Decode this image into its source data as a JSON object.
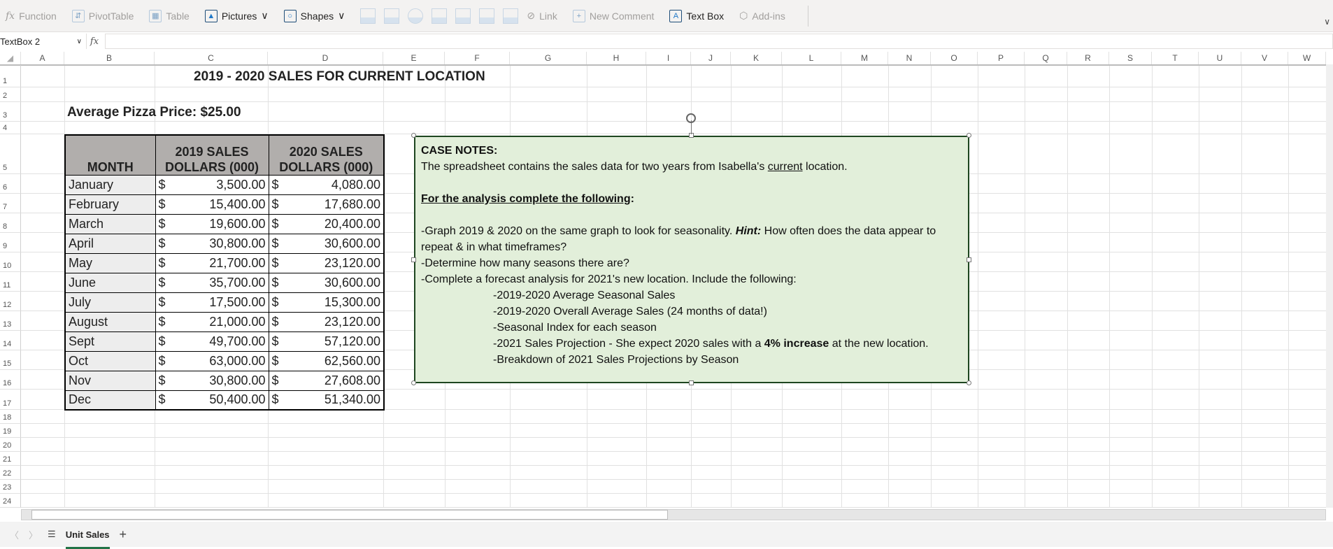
{
  "toolbar": {
    "items": [
      {
        "label": "Function",
        "icon": "fx-icon",
        "enabled": false
      },
      {
        "label": "PivotTable",
        "icon": "pivottable-icon",
        "enabled": false
      },
      {
        "label": "Table",
        "icon": "table-icon",
        "enabled": false
      },
      {
        "label": "Pictures",
        "icon": "pictures-icon",
        "enabled": true,
        "dropdown": "∨"
      },
      {
        "label": "Shapes",
        "icon": "shapes-icon",
        "enabled": true,
        "dropdown": "∨"
      }
    ],
    "link": "Link",
    "new_comment": "New Comment",
    "text_box": "Text Box",
    "addins": "Add-ins"
  },
  "formula_bar": {
    "name_box": "TextBox 2",
    "fx": "fx",
    "value": ""
  },
  "columns": [
    "A",
    "B",
    "C",
    "D",
    "E",
    "F",
    "G",
    "H",
    "I",
    "J",
    "K",
    "L",
    "M",
    "N",
    "O",
    "P",
    "Q",
    "R",
    "S",
    "T",
    "U",
    "V",
    "W"
  ],
  "rows": [
    "1",
    "2",
    "3",
    "4",
    "5",
    "6",
    "7",
    "8",
    "9",
    "10",
    "11",
    "12",
    "13",
    "14",
    "15",
    "16",
    "17",
    "18",
    "19",
    "20",
    "21",
    "22",
    "23",
    "24"
  ],
  "sheet": {
    "title": "2019 - 2020 SALES FOR CURRENT LOCATION",
    "avg_price": "Average Pizza Price: $25.00",
    "headers": {
      "month": "MONTH",
      "y2019_1": "2019 SALES",
      "y2019_2": "DOLLARS (000)",
      "y2020_1": "2020 SALES",
      "y2020_2": "DOLLARS (000)"
    },
    "currency": "$",
    "data": [
      {
        "month": "January",
        "s2019": "3,500.00",
        "s2020": "4,080.00"
      },
      {
        "month": "February",
        "s2019": "15,400.00",
        "s2020": "17,680.00"
      },
      {
        "month": "March",
        "s2019": "19,600.00",
        "s2020": "20,400.00"
      },
      {
        "month": "April",
        "s2019": "30,800.00",
        "s2020": "30,600.00"
      },
      {
        "month": "May",
        "s2019": "21,700.00",
        "s2020": "23,120.00"
      },
      {
        "month": "June",
        "s2019": "35,700.00",
        "s2020": "30,600.00"
      },
      {
        "month": "July",
        "s2019": "17,500.00",
        "s2020": "15,300.00"
      },
      {
        "month": "August",
        "s2019": "21,000.00",
        "s2020": "23,120.00"
      },
      {
        "month": "Sept",
        "s2019": "49,700.00",
        "s2020": "57,120.00"
      },
      {
        "month": "Oct",
        "s2019": "63,000.00",
        "s2020": "62,560.00"
      },
      {
        "month": "Nov",
        "s2019": "30,800.00",
        "s2020": "27,608.00"
      },
      {
        "month": "Dec",
        "s2019": "50,400.00",
        "s2020": "51,340.00"
      }
    ]
  },
  "textbox": {
    "heading": "CASE NOTES:",
    "intro_a": "The spreadsheet contains the sales data for two years from Isabella's ",
    "intro_u": "current",
    "intro_b": " location.",
    "subheading": "For the analysis complete the following",
    "colon": ":",
    "l1a": "-Graph 2019 & 2020 on the same graph to look for seasonality. ",
    "l1hint": "Hint:",
    "l1b": " How often does the data appear to repeat & in what timeframes?",
    "l2": "-Determine how many seasons there are?",
    "l3": "-Complete a forecast analysis for 2021's new location. Include the following:",
    "s1": "-2019-2020 Average Seasonal Sales",
    "s2": "-2019-2020 Overall Average Sales (24 months of data!)",
    "s3": "-Seasonal Index for each season",
    "s4a": "-2021 Sales Projection - She expect 2020 sales with a ",
    "s4b": "4% increase",
    "s4c": " at the new location.",
    "s5": "-Breakdown of 2021 Sales Projections by Season"
  },
  "tabs": {
    "prev": "〈",
    "next": "〉",
    "menu": "☰",
    "sheet": "Unit Sales",
    "add": "+"
  }
}
